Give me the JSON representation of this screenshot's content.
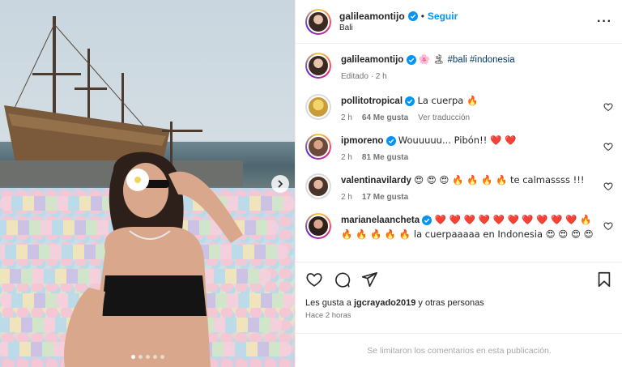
{
  "post": {
    "username": "galileamontijo",
    "follow_label": "Seguir",
    "separator": "•",
    "location": "Bali",
    "more_label": "···"
  },
  "caption": {
    "username": "galileamontijo",
    "emoji": "🌸 🏝",
    "tags": "#bali #indonesia",
    "edited": "Editado · 2 h"
  },
  "comments": [
    {
      "username": "pollitotropical",
      "text": "La cuerpa 🔥",
      "time": "2 h",
      "likes": "64 Me gusta",
      "translate": "Ver traducción"
    },
    {
      "username": "ipmoreno",
      "text": "Wouuuuu... Pibón!! ❤️ ❤️",
      "time": "2 h",
      "likes": "81 Me gusta",
      "translate": ""
    },
    {
      "username": "valentinavilardy",
      "text": "😍 😍 😍 🔥 🔥 🔥 🔥 te calmassss !!!",
      "time": "2 h",
      "likes": "17 Me gusta",
      "translate": ""
    },
    {
      "username": "marianelaancheta",
      "text": "❤️ ❤️ ❤️ ❤️ ❤️ ❤️ ❤️ ❤️ ❤️ ❤️ 🔥 🔥 🔥 🔥 🔥 🔥 la cuerpaaaaa en Indonesia 😍 😍 😍 😍",
      "time": "",
      "likes": "",
      "translate": ""
    }
  ],
  "footer": {
    "likes_prefix": "Les gusta a ",
    "likes_user": "jgcrayado2019",
    "likes_suffix": " y otras personas",
    "time": "Hace 2 horas",
    "limited": "Se limitaron los comentarios en esta publicación."
  },
  "carousel": {
    "total_dots": 5,
    "active_index": 0
  },
  "colors": {
    "link": "#0095f6",
    "tag": "#00376b",
    "muted": "#737373"
  }
}
